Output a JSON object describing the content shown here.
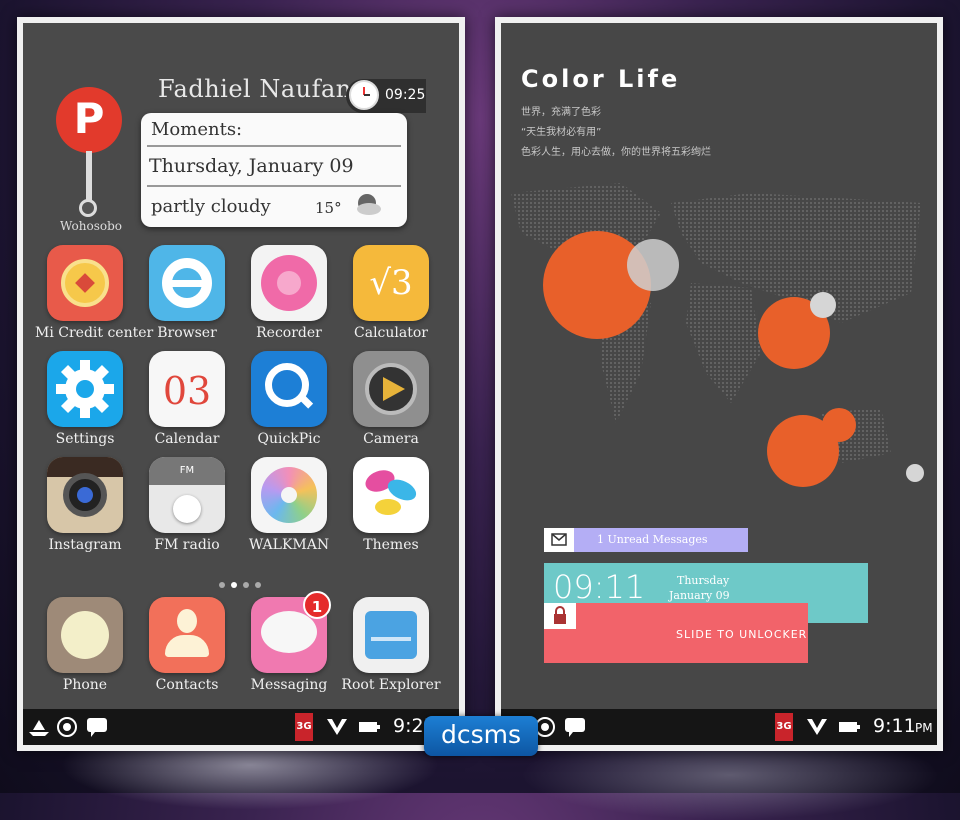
{
  "left_screen": {
    "profile_name": "Fadhiel Naufan",
    "clock_time": "09:25",
    "pinterest_label": "Wohosobo",
    "card": {
      "title": "Moments:",
      "date": "Thursday, January 09",
      "weather": "partly cloudy",
      "temperature": "15°"
    },
    "apps": [
      {
        "label": "Mi Credit center",
        "icon": "credit-coin-icon"
      },
      {
        "label": "Browser",
        "icon": "browser-icon"
      },
      {
        "label": "Recorder",
        "icon": "recorder-icon"
      },
      {
        "label": "Calculator",
        "icon": "calculator-icon"
      },
      {
        "label": "Settings",
        "icon": "gear-icon"
      },
      {
        "label": "Calendar",
        "icon": "calendar-icon"
      },
      {
        "label": "QuickPic",
        "icon": "quickpic-icon"
      },
      {
        "label": "Camera",
        "icon": "camera-icon"
      },
      {
        "label": "Instagram",
        "icon": "instagram-icon"
      },
      {
        "label": "FM radio",
        "icon": "radio-icon"
      },
      {
        "label": "WALKMAN",
        "icon": "walkman-icon"
      },
      {
        "label": "Themes",
        "icon": "themes-icon"
      }
    ],
    "dock": [
      {
        "label": "Phone",
        "icon": "phone-icon"
      },
      {
        "label": "Contacts",
        "icon": "contacts-icon"
      },
      {
        "label": "Messaging",
        "icon": "messaging-icon",
        "badge": "1"
      },
      {
        "label": "Root Explorer",
        "icon": "folder-icon"
      }
    ],
    "calendar_icon_day": "03",
    "calculator_glyph": "√3",
    "fm_label": "FM",
    "status_time": "9:25",
    "network": "3G"
  },
  "right_screen": {
    "title": "Color Life",
    "lines": [
      "世界，充满了色彩",
      "“天生我材必有用”",
      "色彩人生，用心去做，你的世界将五彩绚烂"
    ],
    "messages": "1 Unread Messages",
    "time": "09:11",
    "day": "Thursday",
    "date": "January 09",
    "unlock": "SLIDE TO UNLOCKER",
    "status_time": "9:11",
    "status_ampm": "PM",
    "network": "3G"
  },
  "watermark": "dcsms",
  "colors": {
    "bubble_orange": "#e8602a",
    "msg_purple": "#b4aef5",
    "time_teal": "#6ec9c8",
    "unlock_red": "#f2636a"
  }
}
